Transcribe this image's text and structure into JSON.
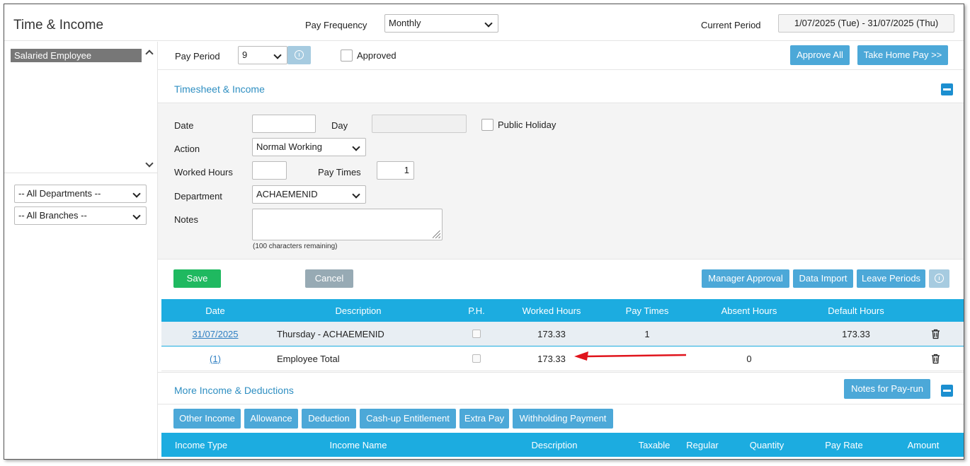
{
  "header": {
    "title": "Time & Income",
    "pay_frequency_label": "Pay Frequency",
    "pay_frequency_value": "Monthly",
    "current_period_label": "Current Period",
    "current_period_value": "1/07/2025 (Tue) - 31/07/2025 (Thu)"
  },
  "sidebar": {
    "employees": [
      "Salaried Employee"
    ],
    "department_filter": "-- All Departments --",
    "branch_filter": "-- All Branches --"
  },
  "pay_period": {
    "label": "Pay Period",
    "value": "9",
    "approved_label": "Approved",
    "approve_all_label": "Approve All",
    "take_home_pay_label": "Take Home Pay >>"
  },
  "timesheet": {
    "section_title": "Timesheet & Income",
    "date_label": "Date",
    "date_value": "",
    "day_label": "Day",
    "day_value": "",
    "public_holiday_label": "Public Holiday",
    "action_label": "Action",
    "action_value": "Normal Working",
    "worked_hours_label": "Worked Hours",
    "worked_hours_value": "",
    "pay_times_label": "Pay Times",
    "pay_times_value": "1",
    "department_label": "Department",
    "department_value": "ACHAEMENID",
    "notes_label": "Notes",
    "notes_remaining": "(100 characters remaining)",
    "save_label": "Save",
    "cancel_label": "Cancel",
    "manager_approval_label": "Manager Approval",
    "data_import_label": "Data Import",
    "leave_periods_label": "Leave Periods"
  },
  "timesheet_table": {
    "columns": [
      "Date",
      "Description",
      "P.H.",
      "Worked Hours",
      "Pay Times",
      "Absent Hours",
      "Default Hours"
    ],
    "rows": [
      {
        "date": "31/07/2025",
        "description": "Thursday - ACHAEMENID",
        "worked_hours": "173.33",
        "pay_times": "1",
        "absent_hours": "",
        "default_hours": "173.33"
      },
      {
        "date": "(1)",
        "description": "Employee Total",
        "worked_hours": "173.33",
        "pay_times": "",
        "absent_hours": "0",
        "default_hours": ""
      }
    ]
  },
  "more_income": {
    "section_title": "More Income & Deductions",
    "notes_button_label": "Notes for Pay-run",
    "tabs": [
      "Other Income",
      "Allowance",
      "Deduction",
      "Cash-up Entitlement",
      "Extra Pay",
      "Withholding Payment"
    ],
    "columns": [
      "Income Type",
      "Income Name",
      "Description",
      "Taxable",
      "Regular",
      "Quantity",
      "Pay Rate",
      "Amount"
    ]
  },
  "colors": {
    "accent_blue": "#1cace0",
    "button_blue": "#4ca8d8",
    "save_green": "#1fb960",
    "annotation_arrow": "#e0141c"
  }
}
